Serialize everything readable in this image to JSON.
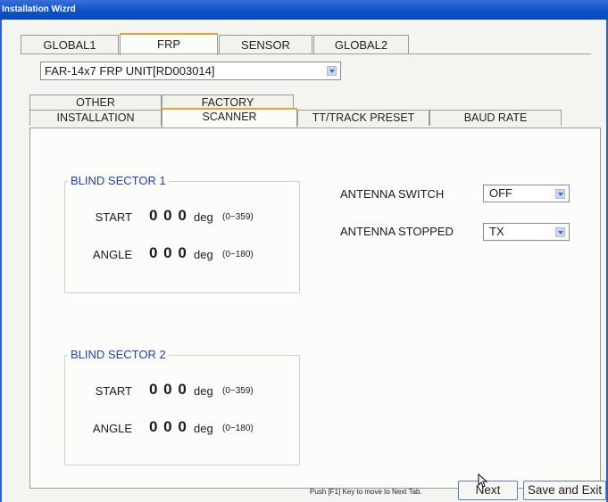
{
  "window": {
    "title": "Installation Wizrd"
  },
  "top_tabs": [
    {
      "label": "GLOBAL1",
      "active": false
    },
    {
      "label": "FRP",
      "active": true
    },
    {
      "label": "SENSOR",
      "active": false
    },
    {
      "label": "GLOBAL2",
      "active": false
    }
  ],
  "unit_select": {
    "value": "FAR-14x7 FRP UNIT[RD003014]"
  },
  "sub_tabs_row1": [
    {
      "label": "OTHER",
      "active": false
    },
    {
      "label": "FACTORY",
      "active": false
    }
  ],
  "sub_tabs_row2": [
    {
      "label": "INSTALLATION",
      "active": false
    },
    {
      "label": "SCANNER",
      "active": true
    },
    {
      "label": "TT/TRACK PRESET",
      "active": false
    },
    {
      "label": "BAUD RATE",
      "active": false
    }
  ],
  "blind_sector_1": {
    "title": "BLIND SECTOR 1",
    "start": {
      "label": "START",
      "value": "0 0 0",
      "unit": "deg",
      "range": "(0~359)"
    },
    "angle": {
      "label": "ANGLE",
      "value": "0 0 0",
      "unit": "deg",
      "range": "(0~180)"
    }
  },
  "blind_sector_2": {
    "title": "BLIND SECTOR 2",
    "start": {
      "label": "START",
      "value": "0 0 0",
      "unit": "deg",
      "range": "(0~359)"
    },
    "angle": {
      "label": "ANGLE",
      "value": "0 0 0",
      "unit": "deg",
      "range": "(0~180)"
    }
  },
  "antenna_switch": {
    "label": "ANTENNA SWITCH",
    "value": "OFF"
  },
  "antenna_stopped": {
    "label": "ANTENNA STOPPED",
    "value": "TX"
  },
  "footer": {
    "hint": "Push [F1] Key to move to Next Tab.",
    "next_label": "Next",
    "save_exit_label": "Save and Exit"
  },
  "colors": {
    "title_bar": "#0b52c8",
    "active_tab_accent": "#f0a030",
    "group_title": "#2a3fa8"
  },
  "icons": [
    "chevron-down-icon",
    "mouse-cursor-icon"
  ]
}
